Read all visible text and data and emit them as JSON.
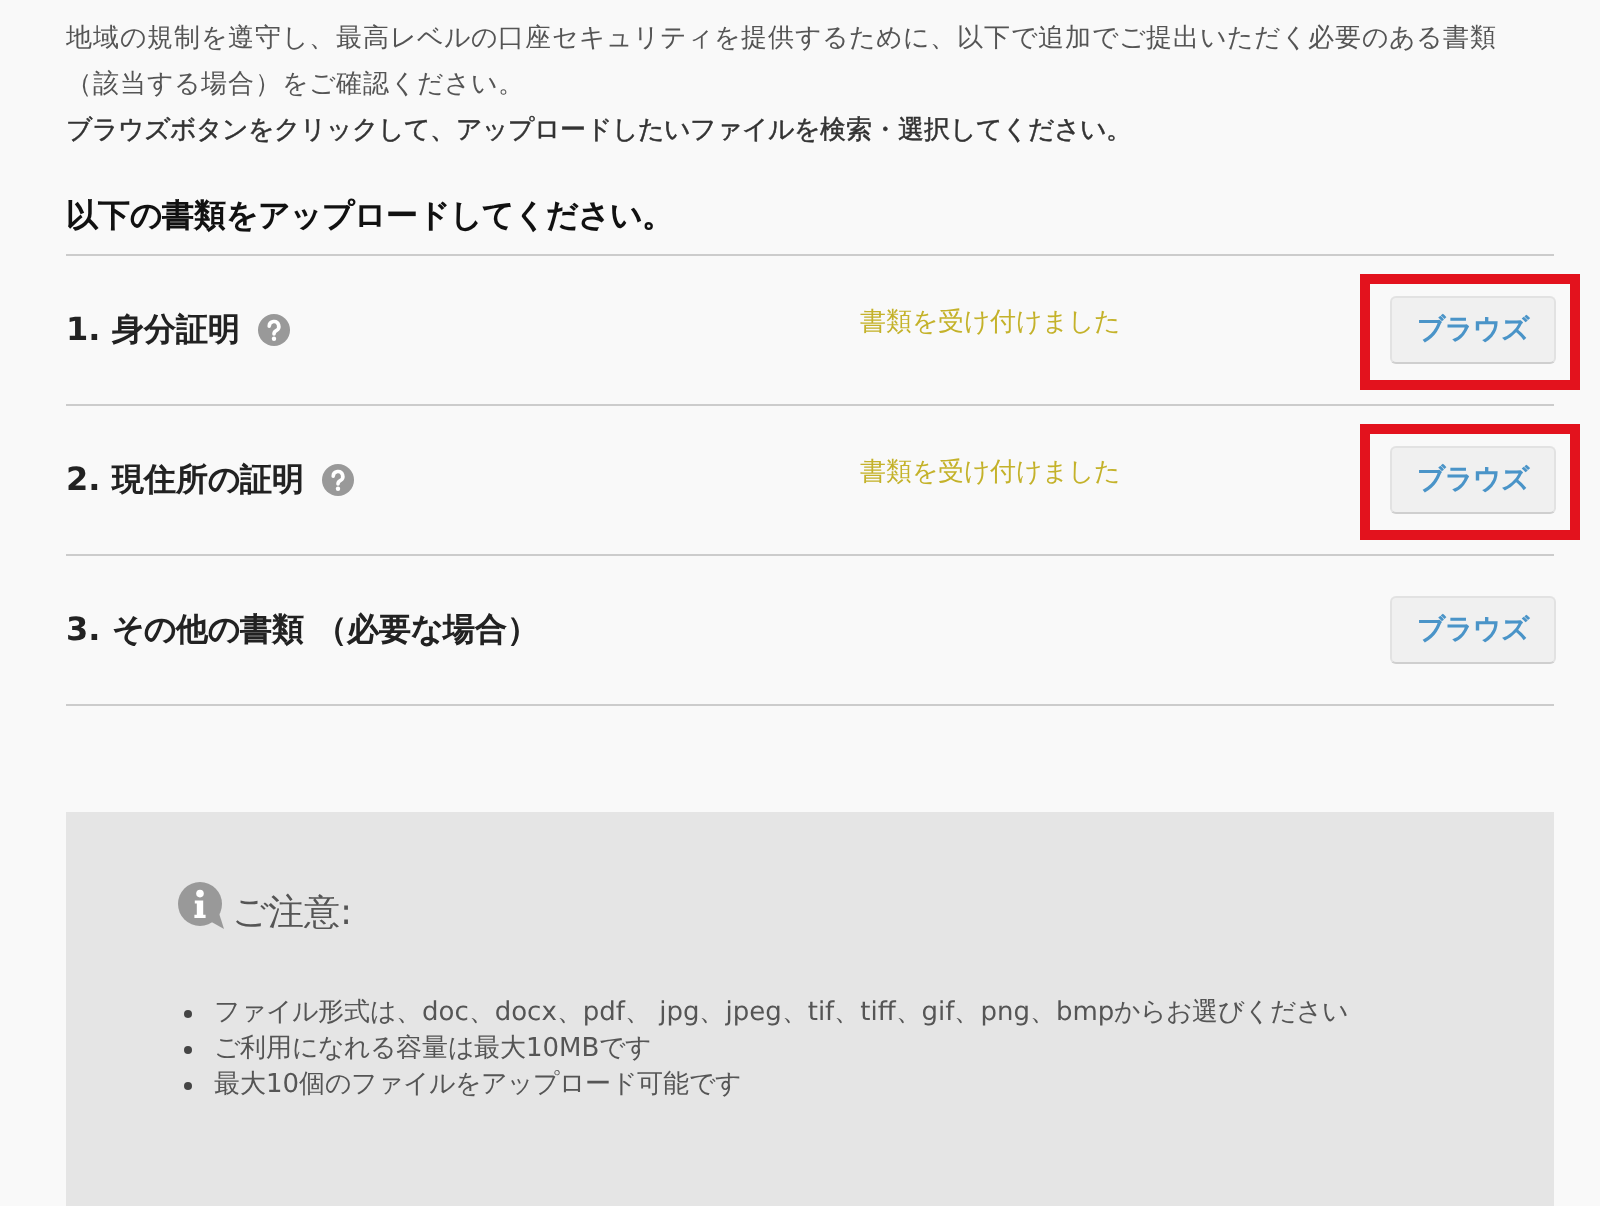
{
  "intro": {
    "description": "地域の規制を遵守し、最高レベルの口座セキュリティを提供するために、以下で追加でご提出いただく必要のある書類（該当する場合）をご確認ください。",
    "instruction": "ブラウズボタンをクリックして、アップロードしたいファイルを検索・選択してください。"
  },
  "upload": {
    "heading": "以下の書類をアップロードしてください。",
    "documents": [
      {
        "title": "1. 身分証明",
        "help": true,
        "status": "書類を受け付けました",
        "button": "ブラウズ",
        "highlighted": true
      },
      {
        "title": "2. 現住所の証明",
        "help": true,
        "status": "書類を受け付けました",
        "button": "ブラウズ",
        "highlighted": true
      },
      {
        "title": "3. その他の書類 （必要な場合）",
        "help": false,
        "button": "ブラウズ",
        "highlighted": false
      }
    ]
  },
  "notes": {
    "title": "ご注意:",
    "items": [
      "ファイル形式は、doc、docx、pdf、 jpg、jpeg、tif、tiff、gif、png、bmpからお選びください",
      "ご利用になれる容量は最大10MBです",
      "最大10個のファイルをアップロード可能です"
    ]
  }
}
